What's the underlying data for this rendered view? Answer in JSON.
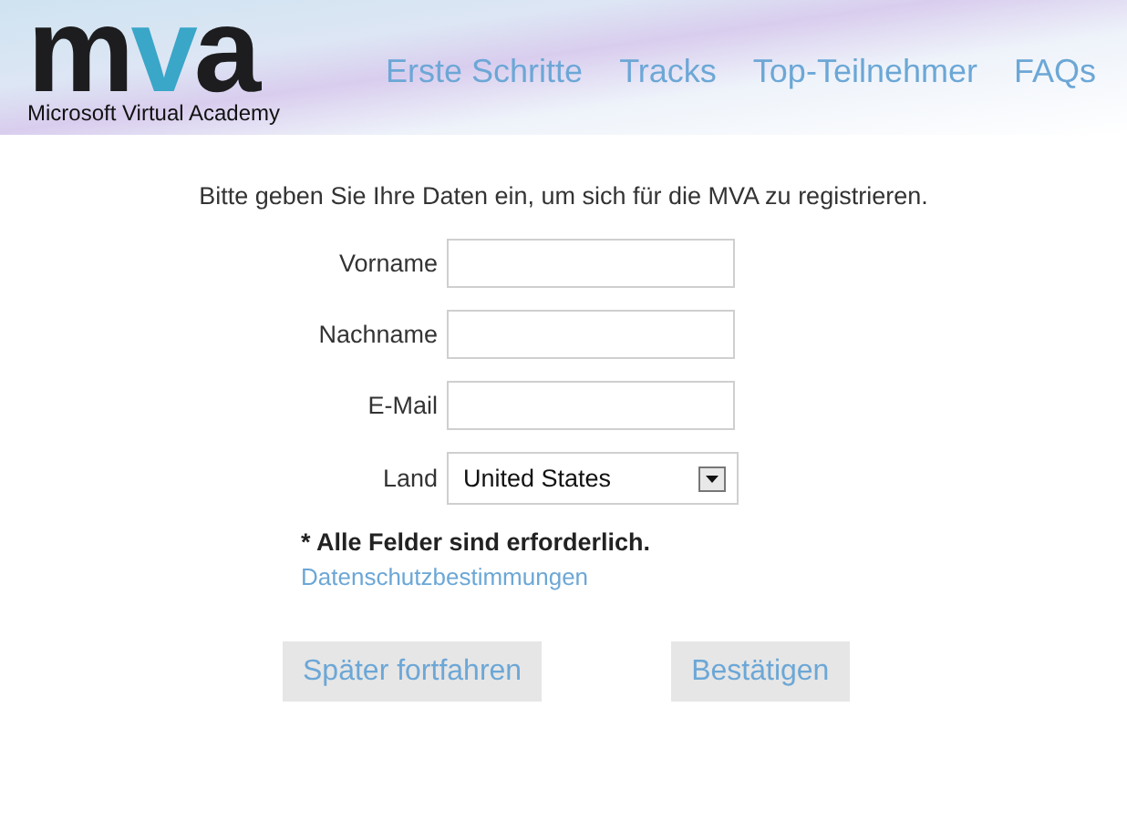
{
  "header": {
    "logo": "mva",
    "tagline": "Microsoft Virtual Academy",
    "nav": [
      "Erste Schritte",
      "Tracks",
      "Top-Teilnehmer",
      "FAQs"
    ]
  },
  "intro": "Bitte geben Sie Ihre Daten ein, um sich für die MVA zu registrieren.",
  "form": {
    "fields": [
      {
        "kind": "text",
        "label": "Vorname"
      },
      {
        "kind": "text",
        "label": "Nachname"
      },
      {
        "kind": "text",
        "label": "E-Mail"
      },
      {
        "kind": "select",
        "label": "Land",
        "value": "United States"
      }
    ],
    "required_note": "* Alle Felder sind erforderlich.",
    "privacy_link": "Datenschutzbestimmungen"
  },
  "buttons": [
    "Später fortfahren",
    "Bestätigen"
  ]
}
